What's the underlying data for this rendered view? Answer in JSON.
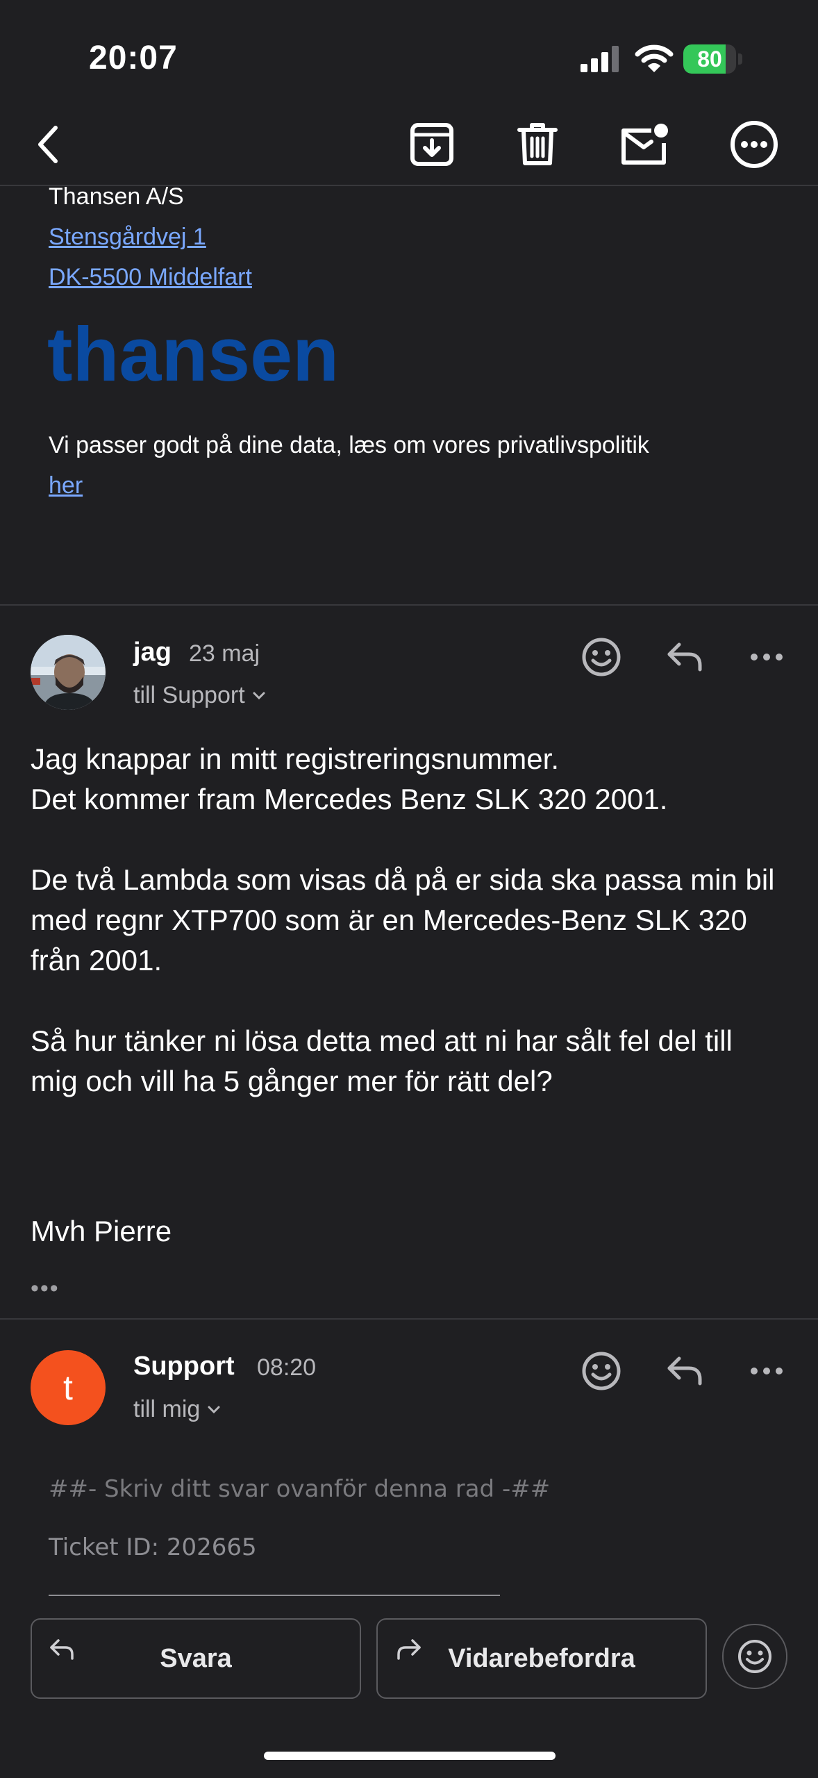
{
  "status_bar": {
    "time": "20:07",
    "battery": "80",
    "battery_level": 0.8
  },
  "toolbar": {
    "icons": [
      "chevron-left-icon",
      "archive-icon",
      "trash-icon",
      "mark-unread-icon",
      "more-icon"
    ]
  },
  "email_footer": {
    "company": "Thansen A/S",
    "street": "Stensgårdvej 1",
    "city": "DK-5500 Middelfart",
    "logo_text": "thansen",
    "logo_color": "#0a4aa0",
    "privacy_text": "Vi passer godt på dine data, læs om vores privatlivspolitik",
    "privacy_link": "her"
  },
  "message_1": {
    "sender": "jag",
    "date": "23 maj",
    "recipient": "till Support",
    "body": [
      "Jag knappar in mitt registreringsnummer.",
      "Det kommer fram Mercedes Benz SLK 320 2001.",
      "De två Lambda som visas då på er sida ska passa min bil med regnr XTP700 som är en Mercedes-Benz SLK 320 från 2001.",
      "Så hur tänker ni lösa detta med att ni har sålt fel del till mig och vill ha 5 gånger mer för rätt del?"
    ],
    "signature": "Mvh Pierre",
    "collapsed": "•••"
  },
  "message_2": {
    "sender": "Support",
    "avatar_letter": "t",
    "avatar_color": "#f4511e",
    "time": "08:20",
    "recipient": "till mig",
    "reply_marker": "##- Skriv ditt svar ovanför denna rad -##",
    "ticket": "Ticket ID: 202665"
  },
  "actions": {
    "reply": "Svara",
    "forward": "Vidarebefordra"
  }
}
